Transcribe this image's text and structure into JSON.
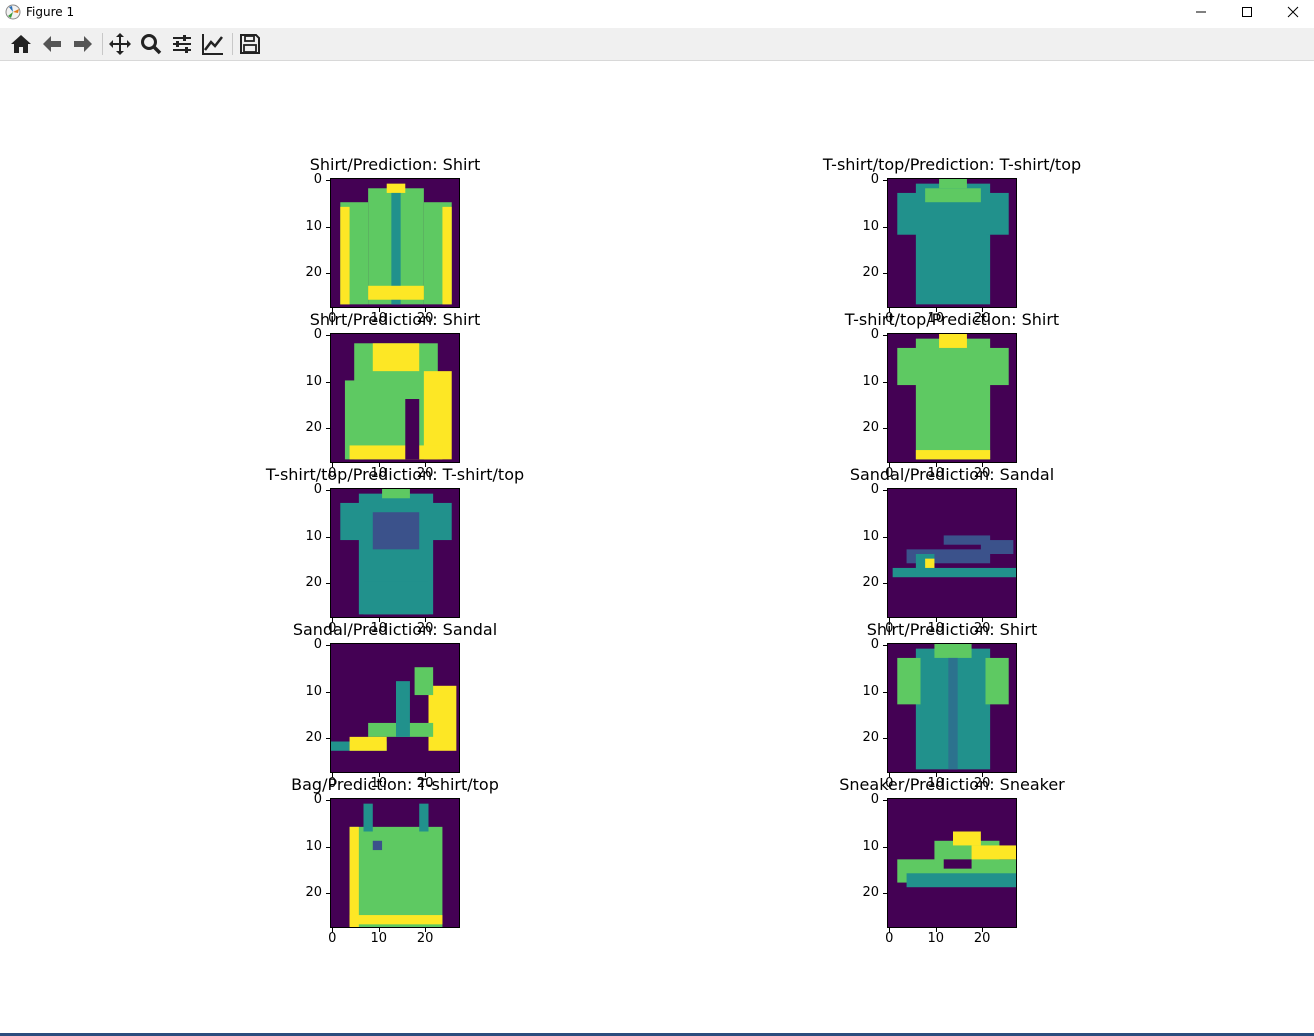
{
  "window": {
    "title": "Figure 1",
    "controls": [
      "minimize-icon",
      "maximize-icon",
      "close-icon"
    ]
  },
  "toolbar": {
    "buttons": [
      {
        "name": "home-icon",
        "label": "Home"
      },
      {
        "name": "back-icon",
        "label": "Back"
      },
      {
        "name": "forward-icon",
        "label": "Forward"
      },
      {
        "name": "pan-icon",
        "label": "Pan"
      },
      {
        "name": "zoom-icon",
        "label": "Zoom"
      },
      {
        "name": "subplots-icon",
        "label": "Configure subplots"
      },
      {
        "name": "edit-axes-icon",
        "label": "Edit axis"
      },
      {
        "name": "save-icon",
        "label": "Save"
      }
    ]
  },
  "colors": {
    "background": "#440154",
    "low": "#21918c",
    "mid": "#5ec962",
    "high": "#fde725"
  },
  "chart_data": {
    "type": "image-grid",
    "image_size": [
      28,
      28
    ],
    "yticks": [
      "0",
      "10",
      "20"
    ],
    "xticks": [
      "0",
      "10",
      "20"
    ],
    "panels": [
      {
        "title": "Shirt/Prediction: Shirt",
        "shape": "shirt-long"
      },
      {
        "title": "T-shirt/top/Prediction: T-shirt/top",
        "shape": "tshirt"
      },
      {
        "title": "Shirt/Prediction: Shirt",
        "shape": "shirt-folded"
      },
      {
        "title": "T-shirt/top/Prediction: Shirt",
        "shape": "tshirt-bright"
      },
      {
        "title": "T-shirt/top/Prediction: T-shirt/top",
        "shape": "tshirt-print"
      },
      {
        "title": "Sandal/Prediction: Sandal",
        "shape": "sandal-flat"
      },
      {
        "title": "Sandal/Prediction: Sandal",
        "shape": "sandal-heel"
      },
      {
        "title": "Shirt/Prediction: Shirt",
        "shape": "shirt-short"
      },
      {
        "title": "Bag/Prediction: T-shirt/top",
        "shape": "bag"
      },
      {
        "title": "Sneaker/Prediction: Sneaker",
        "shape": "sneaker"
      }
    ]
  }
}
